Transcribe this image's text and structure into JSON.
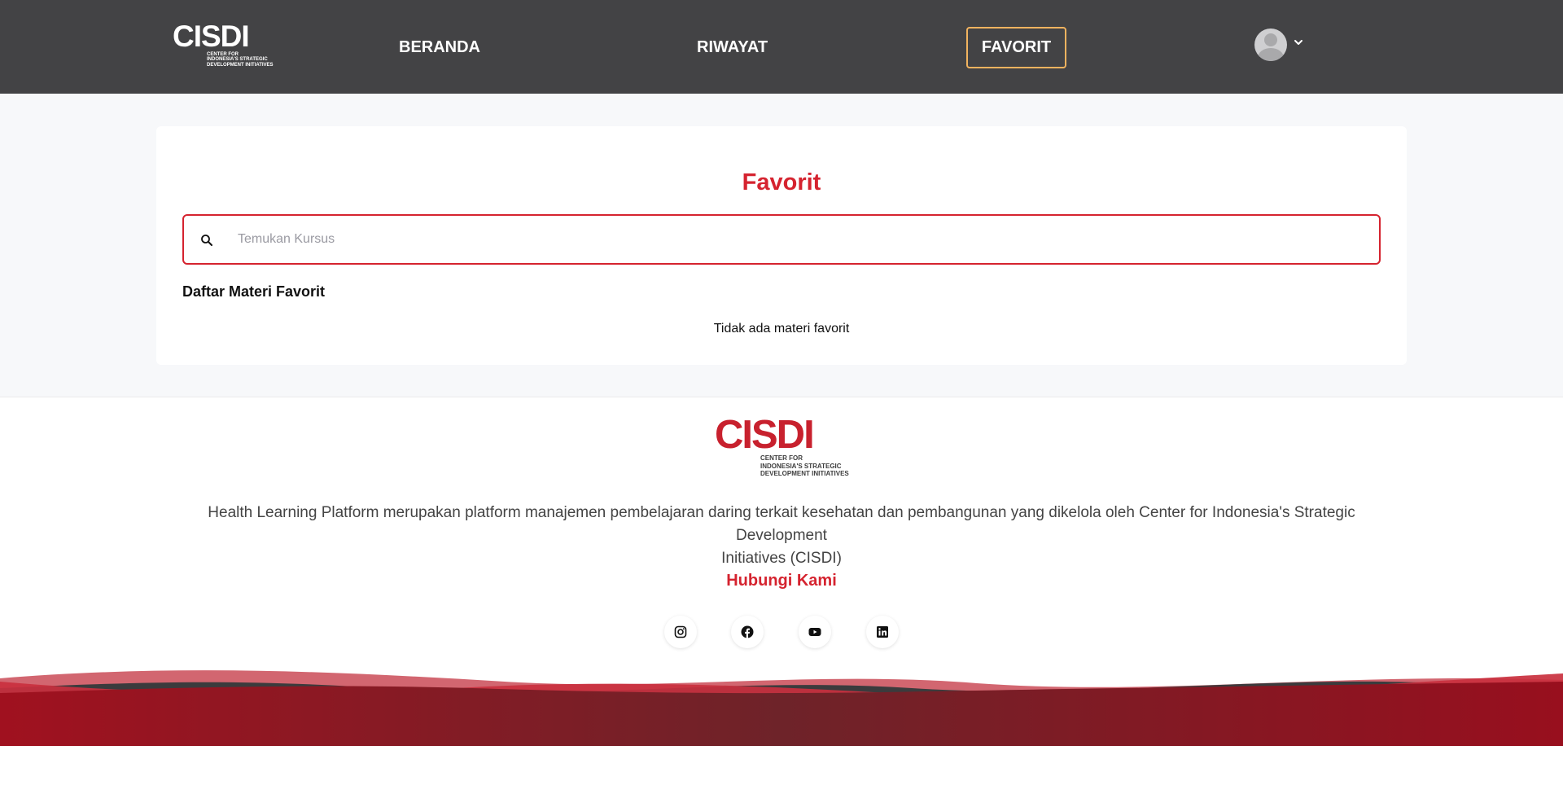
{
  "header": {
    "logo": {
      "text": "CISDI",
      "sub": [
        "CENTER FOR",
        "INDONESIA'S STRATEGIC",
        "DEVELOPMENT INITIATIVES"
      ]
    },
    "nav": [
      {
        "label": "BERANDA"
      },
      {
        "label": "RIWAYAT"
      },
      {
        "label": "FAVORIT",
        "active": true
      }
    ],
    "user_menu": {
      "avatar_icon": "user-avatar-icon",
      "chevron_icon": "chevron-down-icon"
    }
  },
  "main": {
    "title": "Favorit",
    "search": {
      "placeholder": "Temukan Kursus",
      "value": "",
      "icon": "search-icon"
    },
    "section_title": "Daftar Materi Favorit",
    "empty_message": "Tidak ada materi favorit"
  },
  "footer": {
    "logo": {
      "text": "CISDI",
      "sub": [
        "CENTER FOR",
        "INDONESIA'S STRATEGIC",
        "DEVELOPMENT INITIATIVES"
      ]
    },
    "description_line1": "Health Learning Platform merupakan platform manajemen pembelajaran daring terkait kesehatan dan pembangunan yang dikelola oleh Center for Indonesia's Strategic Development",
    "description_line2": "Initiatives (CISDI)",
    "contact_title": "Hubungi Kami",
    "socials": [
      {
        "name": "instagram-icon"
      },
      {
        "name": "facebook-icon"
      },
      {
        "name": "youtube-icon"
      },
      {
        "name": "linkedin-icon"
      }
    ]
  },
  "colors": {
    "header_bg": "#434345",
    "brand_red": "#d5232f",
    "active_border": "#f2b35f",
    "page_bg": "#f7f8fa"
  }
}
